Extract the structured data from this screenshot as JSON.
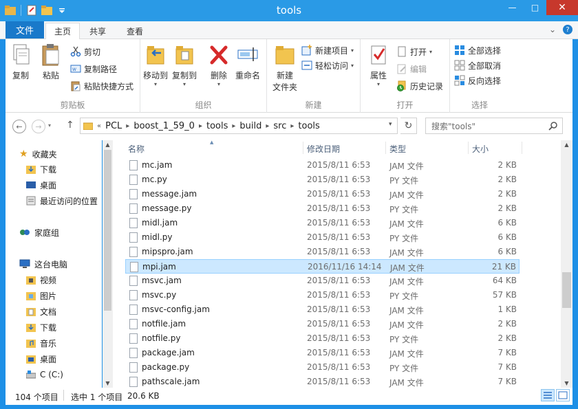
{
  "window": {
    "title": "tools",
    "minimize": "—",
    "maximize": "□",
    "close": "✕"
  },
  "tabs": {
    "file": "文件",
    "home": "主页",
    "share": "共享",
    "view": "查看"
  },
  "ribbon": {
    "clipboard": {
      "label": "剪贴板",
      "copy": "复制",
      "paste": "粘贴",
      "cut": "剪切",
      "copy_path": "复制路径",
      "paste_shortcut": "粘贴快捷方式"
    },
    "organize": {
      "label": "组织",
      "move_to": "移动到",
      "copy_to": "复制到",
      "delete": "删除",
      "rename": "重命名"
    },
    "new": {
      "label": "新建",
      "new_folder_line1": "新建",
      "new_folder_line2": "文件夹",
      "new_item": "新建项目",
      "easy_access": "轻松访问"
    },
    "open": {
      "label": "打开",
      "properties": "属性",
      "open": "打开",
      "edit": "编辑",
      "history": "历史记录"
    },
    "select": {
      "label": "选择",
      "select_all": "全部选择",
      "select_none": "全部取消",
      "invert": "反向选择"
    }
  },
  "address": {
    "overflow": "«",
    "crumbs": [
      "PCL",
      "boost_1_59_0",
      "tools",
      "build",
      "src",
      "tools"
    ],
    "search_placeholder": "搜索\"tools\""
  },
  "nav": {
    "favorites": "收藏夹",
    "downloads": "下载",
    "desktop": "桌面",
    "recent": "最近访问的位置",
    "homegroup": "家庭组",
    "this_pc": "这台电脑",
    "videos": "视频",
    "pictures": "图片",
    "documents": "文档",
    "downloads2": "下载",
    "music": "音乐",
    "desktop2": "桌面",
    "drive_c": "C (C:)"
  },
  "columns": {
    "name": "名称",
    "date": "修改日期",
    "type": "类型",
    "size": "大小"
  },
  "files": [
    {
      "name": "mc.jam",
      "date": "2015/8/11 6:53",
      "type": "JAM 文件",
      "size": "2 KB"
    },
    {
      "name": "mc.py",
      "date": "2015/8/11 6:53",
      "type": "PY 文件",
      "size": "2 KB"
    },
    {
      "name": "message.jam",
      "date": "2015/8/11 6:53",
      "type": "JAM 文件",
      "size": "2 KB"
    },
    {
      "name": "message.py",
      "date": "2015/8/11 6:53",
      "type": "PY 文件",
      "size": "2 KB"
    },
    {
      "name": "midl.jam",
      "date": "2015/8/11 6:53",
      "type": "JAM 文件",
      "size": "6 KB"
    },
    {
      "name": "midl.py",
      "date": "2015/8/11 6:53",
      "type": "PY 文件",
      "size": "6 KB"
    },
    {
      "name": "mipspro.jam",
      "date": "2015/8/11 6:53",
      "type": "JAM 文件",
      "size": "6 KB"
    },
    {
      "name": "mpi.jam",
      "date": "2016/11/16 14:14",
      "type": "JAM 文件",
      "size": "21 KB"
    },
    {
      "name": "msvc.jam",
      "date": "2015/8/11 6:53",
      "type": "JAM 文件",
      "size": "64 KB"
    },
    {
      "name": "msvc.py",
      "date": "2015/8/11 6:53",
      "type": "PY 文件",
      "size": "57 KB"
    },
    {
      "name": "msvc-config.jam",
      "date": "2015/8/11 6:53",
      "type": "JAM 文件",
      "size": "1 KB"
    },
    {
      "name": "notfile.jam",
      "date": "2015/8/11 6:53",
      "type": "JAM 文件",
      "size": "2 KB"
    },
    {
      "name": "notfile.py",
      "date": "2015/8/11 6:53",
      "type": "PY 文件",
      "size": "2 KB"
    },
    {
      "name": "package.jam",
      "date": "2015/8/11 6:53",
      "type": "JAM 文件",
      "size": "7 KB"
    },
    {
      "name": "package.py",
      "date": "2015/8/11 6:53",
      "type": "PY 文件",
      "size": "7 KB"
    },
    {
      "name": "pathscale.jam",
      "date": "2015/8/11 6:53",
      "type": "JAM 文件",
      "size": "7 KB"
    }
  ],
  "selected_file": "mpi.jam",
  "status": {
    "count": "104 个项目",
    "selected": "选中 1 个项目",
    "size": "20.6 KB"
  },
  "colors": {
    "accent": "#1e90e6",
    "file_tab": "#1979ca",
    "selection": "#cce8ff",
    "close": "#c7382c"
  }
}
